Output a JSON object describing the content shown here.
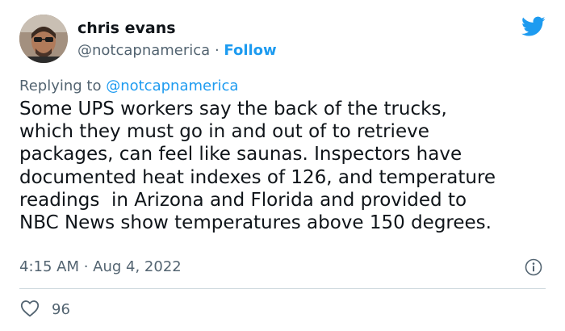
{
  "author": {
    "display_name": "chris evans",
    "handle": "@notcapnamerica",
    "separator": " · ",
    "follow_label": "Follow"
  },
  "reply": {
    "prefix": "Replying to ",
    "mention": "@notcapnamerica"
  },
  "tweet": {
    "lines": [
      "Some UPS workers say the back of the trucks,",
      "which they must go in and out of to retrieve",
      "packages, can feel like saunas. Inspectors have",
      "documented heat indexes of 126, and temperature",
      "readings  in Arizona and Florida and provided to",
      "NBC News show temperatures above 150 degrees."
    ],
    "timestamp": "4:15 AM · Aug 4, 2022"
  },
  "actions": {
    "like_count": "96"
  },
  "icons": {
    "brand": "twitter-bird-icon",
    "info": "info-icon",
    "like": "heart-icon"
  },
  "colors": {
    "brand_blue": "#1d9bf0",
    "secondary_text": "#536471",
    "primary_text": "#0f1419",
    "divider": "#cfd9de"
  }
}
